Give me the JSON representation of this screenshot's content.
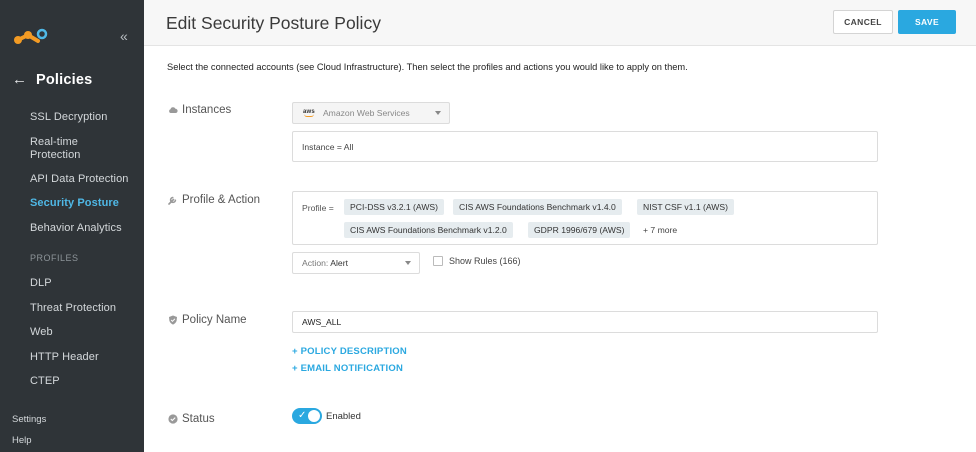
{
  "sidebar": {
    "section_title": "Policies",
    "items": [
      {
        "label": "SSL Decryption"
      },
      {
        "label": "Real-time\nProtection"
      },
      {
        "label": "API Data Protection"
      },
      {
        "label": "Security Posture"
      },
      {
        "label": "Behavior Analytics"
      }
    ],
    "profiles_header": "PROFILES",
    "profile_items": [
      {
        "label": "DLP"
      },
      {
        "label": "Threat Protection"
      },
      {
        "label": "Web"
      },
      {
        "label": "HTTP Header"
      },
      {
        "label": "CTEP"
      }
    ],
    "footer": {
      "settings": "Settings",
      "help": "Help"
    },
    "active_color": "#4fb8e6",
    "background": "#2f3438"
  },
  "header": {
    "title": "Edit Security Posture Policy",
    "cancel_label": "CANCEL",
    "save_label": "SAVE",
    "accent": "#2aa8e0"
  },
  "form": {
    "instructions": "Select the connected accounts (see Cloud Infrastructure). Then select the profiles and actions you would like to apply on them.",
    "instances": {
      "label": "Instances",
      "provider_logo": "aws",
      "provider_value": "Amazon Web Services",
      "instance_value": "Instance = All"
    },
    "profile_action": {
      "label": "Profile & Action",
      "prefix": "Profile =",
      "profiles": [
        "PCI-DSS v3.2.1 (AWS)",
        "CIS AWS Foundations Benchmark v1.4.0",
        "NIST CSF v1.1 (AWS)",
        "CIS AWS Foundations Benchmark v1.2.0",
        "GDPR 1996/679 (AWS)"
      ],
      "more": "+ 7 more",
      "action_prefix": "Action: ",
      "action_value": "Alert",
      "show_rules": "Show Rules (166)"
    },
    "policy_name": {
      "label": "Policy Name",
      "value": "AWS_ALL"
    },
    "links": {
      "policy_description": "+ POLICY DESCRIPTION",
      "email_notification": "+ EMAIL NOTIFICATION"
    },
    "status": {
      "label": "Status",
      "toggle_label": "Enabled",
      "enabled": true
    }
  }
}
